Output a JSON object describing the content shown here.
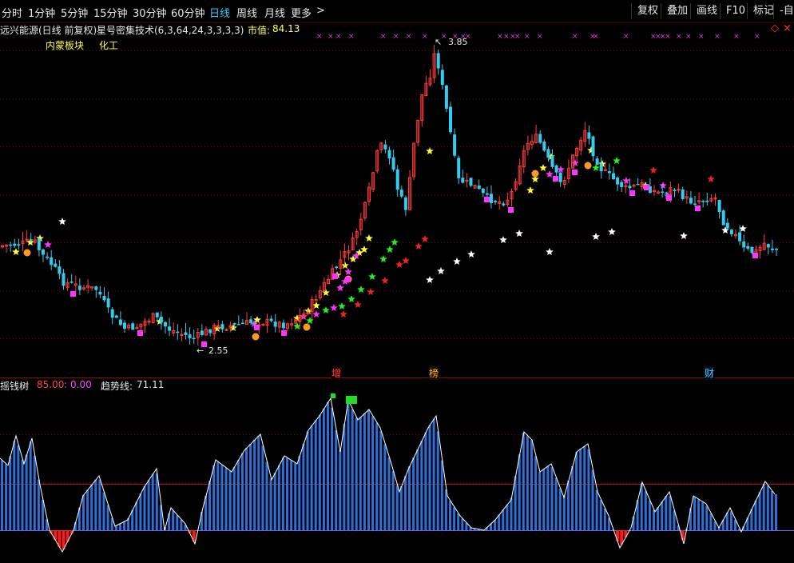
{
  "toolbar": {
    "periods": [
      "分时",
      "1分钟",
      "5分钟",
      "15分钟",
      "30分钟",
      "60分钟",
      "日线",
      "周线",
      "月线",
      "更多"
    ],
    "active_period": "日线",
    "more_arrow": ">",
    "buttons": [
      "复权",
      "叠加",
      "画线",
      "F10",
      "标记",
      "-自"
    ]
  },
  "main_panel": {
    "title": "远兴能源(日线 前复权)",
    "indicator": "星号密集技术(6,3,64,24,3,3,3,3)",
    "market_value_label": "市值:",
    "market_value": "84.13",
    "sectors": [
      "内蒙板块",
      "化工"
    ],
    "high_label": "3.85",
    "low_label": "2.55",
    "event_markers": [
      "增",
      "榜",
      "财"
    ],
    "diamond_icon": "◇",
    "close_icon": "×",
    "colors": {
      "up": "#ff3b3b",
      "down": "#33ccee",
      "magenta": "#ff33ff",
      "yellow": "#ffff33",
      "bg": "#000000"
    }
  },
  "sub_panel": {
    "name": "摇钱树",
    "value1": "85.00",
    "sep": ":",
    "value2": "0.00",
    "trend_label": "趋势线:",
    "trend_value": "71.11"
  }
}
